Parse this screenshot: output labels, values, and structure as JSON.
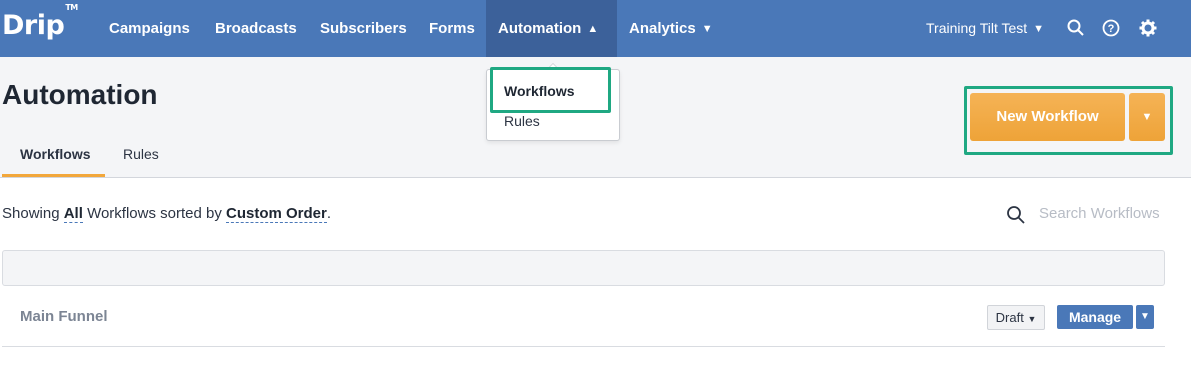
{
  "nav": {
    "logo": "Drip",
    "logo_tm": "TM",
    "items": [
      {
        "label": "Campaigns"
      },
      {
        "label": "Broadcasts"
      },
      {
        "label": "Subscribers"
      },
      {
        "label": "Forms"
      },
      {
        "label": "Automation"
      },
      {
        "label": "Analytics"
      }
    ],
    "account": "Training Tilt Test",
    "icons": [
      "search-icon",
      "help-icon",
      "gear-icon"
    ]
  },
  "dropdown": {
    "items": [
      {
        "label": "Workflows"
      },
      {
        "label": "Rules"
      }
    ]
  },
  "page": {
    "title": "Automation",
    "tabs": [
      {
        "label": "Workflows",
        "active": true
      },
      {
        "label": "Rules",
        "active": false
      }
    ],
    "new_button": "New Workflow"
  },
  "filter": {
    "prefix": "Showing",
    "scope": "All",
    "middle": "Workflows sorted by",
    "sort": "Custom Order",
    "suffix": ".",
    "search_placeholder": "Search Workflows"
  },
  "workflows": [
    {
      "name": "Main Funnel",
      "status": "Draft",
      "action": "Manage"
    }
  ],
  "colors": {
    "nav": "#4a78b8",
    "accent": "#f2a83f",
    "highlight": "#1fa882"
  }
}
